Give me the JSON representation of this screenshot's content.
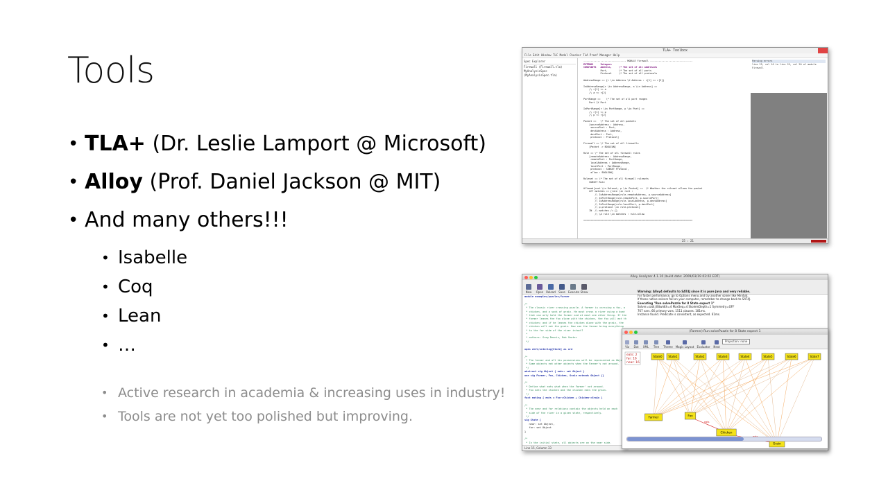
{
  "slide": {
    "title": "Tools",
    "bullets": [
      {
        "bold": "TLA+",
        "rest": " (Dr. Leslie Lamport @ Microsoft)"
      },
      {
        "bold": "Alloy",
        "rest": " (Prof. Daniel Jackson @ MIT)"
      },
      {
        "bold": "",
        "rest": "And many others!!!"
      }
    ],
    "sub_bullets": [
      "Isabelle",
      "Coq",
      "Lean",
      "…"
    ],
    "notes": [
      "Active research in academia & increasing uses in industry!",
      "Tools are not yet too polished but improving."
    ]
  },
  "tla_window": {
    "title": "TLA+ Toolbox",
    "menu": "File  Edit  Window  TLC Model Checker  TLA Proof Manager  Help",
    "spec_explorer": "Spec Explorer",
    "tree_items": [
      "Firewall (Firewall.tla)",
      "MyAnalysisSpec (MyAnalysisSpec.tla)"
    ],
    "parsing_errors_title": "Parsing errors",
    "parsing_error_text": "line 25, col 16 to line 25, col 20 of module Firewall",
    "code": [
      "------------------------------ MODULE Firewall ------------------------------",
      "EXTENDS     Integers",
      "CONSTANTS   Address,     \\* The set of all addresses",
      "            Port,        \\* The set of all ports",
      "            Protocol     \\* The set of all protocols",
      "",
      "AddressRange == {r \\in Address \\X Address : r[1] <= r[2]}",
      "",
      "InAddressRange[r \\in AddressRange, a \\in Address] ==",
      "    /\\ r[1] <= a",
      "    /\\ a <= r[2]",
      "",
      "PortRange ==    \\* The set of all port ranges",
      "    Port \\X Port",
      "",
      "InPortRange[r \\in PortRange, p \\in Port] ==",
      "    /\\ r[1] <= p",
      "    /\\ p <= r[2]",
      "",
      "Packet ==   \\* The set of all packets",
      "    [sourceAddress : Address,",
      "     sourcePort : Port,",
      "     destAddress : Address,",
      "     destPort : Port,",
      "     protocol : Protocol]",
      "",
      "Firewall == \\* The set of all firewalls",
      "    [Packet -> BOOLEAN]",
      "",
      "Rule == \\* The set of all firewall rules",
      "    [remoteAddress : AddressRange,",
      "     remotePort : PortRange,",
      "     localAddress : AddressRange,",
      "     localPort : PortRange,",
      "     protocol : SUBSET Protocol,",
      "     allow : BOOLEAN]",
      "",
      "Ruleset == \\* The set of all firewall rulesets",
      "    SUBSET Rule",
      "",
      "Allowed[rset \\in Ruleset, p \\in Packet] ==  \\* Whether the ruleset allows the packet",
      "    LET matches == {rule \\in rset :",
      "        /\\ InAddressRange[rule.remoteAddress, p.sourceAddress]",
      "        /\\ InPortRange[rule.remotePort, p.sourcePort]",
      "        /\\ InAddressRange[rule.localAddress, p.destAddress]",
      "        /\\ InPortRange[rule.localPort, p.destPort]",
      "        /\\ p.protocol \\in rule.protocol}",
      "    IN  /\\ matches /= {}",
      "        /\\ \\A rule \\in matches : rule.allow",
      "",
      "============================================================================="
    ],
    "status": "25 : 21"
  },
  "alloy_window": {
    "title": "Alloy Analyzer 4.1.10 (build date: 2009/03/19 02:02 EDT)",
    "toolbar": [
      "New",
      "Open",
      "Reload",
      "Save",
      "Execute",
      "Show"
    ],
    "code": [
      "module examples/puzzles/farmer",
      "",
      "/*",
      " * The classic river crossing puzzle. A farmer is carrying a fox, a",
      " * chicken, and a sack of grain. He must cross a river using a boat",
      " * that can only hold the farmer and at most one other thing. If the",
      " * farmer leaves the fox alone with the chicken, the fox will eat the",
      " * chicken; and if he leaves the chicken alone with the grain, the",
      " * chicken will eat the grain. How can the farmer bring everything",
      " * to the far side of the river intact?",
      " *",
      " * authors: Greg Dennis, Rob Seater",
      " */",
      "",
      "open util/ordering[State] as ord",
      "",
      "/*",
      " * The farmer and all his possessions will be represented as Objects.",
      " * Some objects eat other objects when the Farmer's not around.",
      " */",
      "abstract sig Object { eats: set Object }",
      "one sig Farmer, Fox, Chicken, Grain extends Object {}",
      "",
      "/*",
      " * Define what eats what when the Farmer' not around.",
      " * Fox eats the chicken and the chicken eats the grain.",
      " */",
      "fact eating { eats = Fox->Chicken + Chicken->Grain }",
      "",
      "/*",
      " * The near and far relations contain the objects held on each",
      " * side of the river in a given state, respectively.",
      " */",
      "sig State {",
      "   near: set Object,",
      "   far: set Object",
      "}",
      "",
      "/*",
      " * In the initial state, all objects are on the near side."
    ],
    "messages": [
      "Warning: Alloy4 defaults to SAT4J since it is pure Java and very reliable.",
      "For faster performance, go to Options menu and try another solver like MiniSat.",
      "If these native solvers fail on your computer, remember to change back to SAT4J.",
      "",
      "Executing \"Run solvePuzzle for 8 State expect 1\"",
      "   Solver=sat4j Bitwidth=4 MaxSeq=4 SkolemDepth=1 Symmetry=OFF",
      "   767 vars. 66 primary vars. 1511 clauses. 181ms.",
      "   Instance found. Predicate is consistent, as expected. 61ms."
    ],
    "status": "Line 15, Column 33"
  },
  "viz_window": {
    "title": "(Farmer) Run solvePuzzle for 8 State expect 1",
    "toolbar": [
      "Viz",
      "Dot",
      "XML",
      "Tree",
      "Theme",
      "Magic Layout",
      "Evaluator",
      "Next"
    ],
    "projection": "Projection: none",
    "legend": [
      "eats: 2",
      "far: 16",
      "near: 16"
    ],
    "states": [
      "State0",
      "State1",
      "State2",
      "State3",
      "State4",
      "State5",
      "State6",
      "State7"
    ],
    "objects": [
      "Farmer",
      "Fox",
      "Chicken",
      "Grain"
    ],
    "eats_label": "eats"
  },
  "colors": {
    "viz_node": "#f4e21a",
    "viz_edge_near": "#f08a24",
    "viz_edge_far": "#d8a06a",
    "eats_edge": "#d62020",
    "mac_red": "#ff5f57",
    "mac_yellow": "#ffbd2e",
    "mac_green": "#28c940"
  }
}
